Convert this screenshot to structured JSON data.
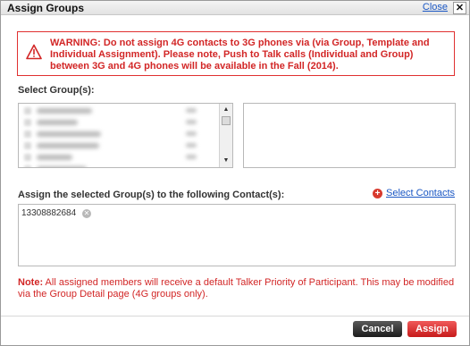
{
  "dialog": {
    "title": "Assign Groups",
    "close_link": "Close",
    "close_x": "✕"
  },
  "warning": {
    "icon": "warning-triangle-icon",
    "text": "WARNING: Do not assign 4G contacts to 3G phones via (via Group, Template and Individual Assignment). Please note, Push to Talk calls (Individual and Group) between 3G and 4G phones will be available in the Fall (2014)."
  },
  "groups": {
    "label": "Select Group(s):",
    "list_rows": 6
  },
  "contacts": {
    "label": "Assign the selected Group(s) to the following Contact(s):",
    "select_link": "Select Contacts",
    "chips": [
      {
        "number": "13308882684"
      }
    ]
  },
  "note": {
    "label": "Note:",
    "text": " All assigned members will receive a default Talker Priority of Participant. This may be modified via the Group Detail page (4G groups only)."
  },
  "buttons": {
    "cancel": "Cancel",
    "assign": "Assign"
  },
  "colors": {
    "warning_red": "#d22626",
    "link_blue": "#1a57c4",
    "assign_red": "#d42222",
    "cancel_dark": "#2a2a2a"
  }
}
